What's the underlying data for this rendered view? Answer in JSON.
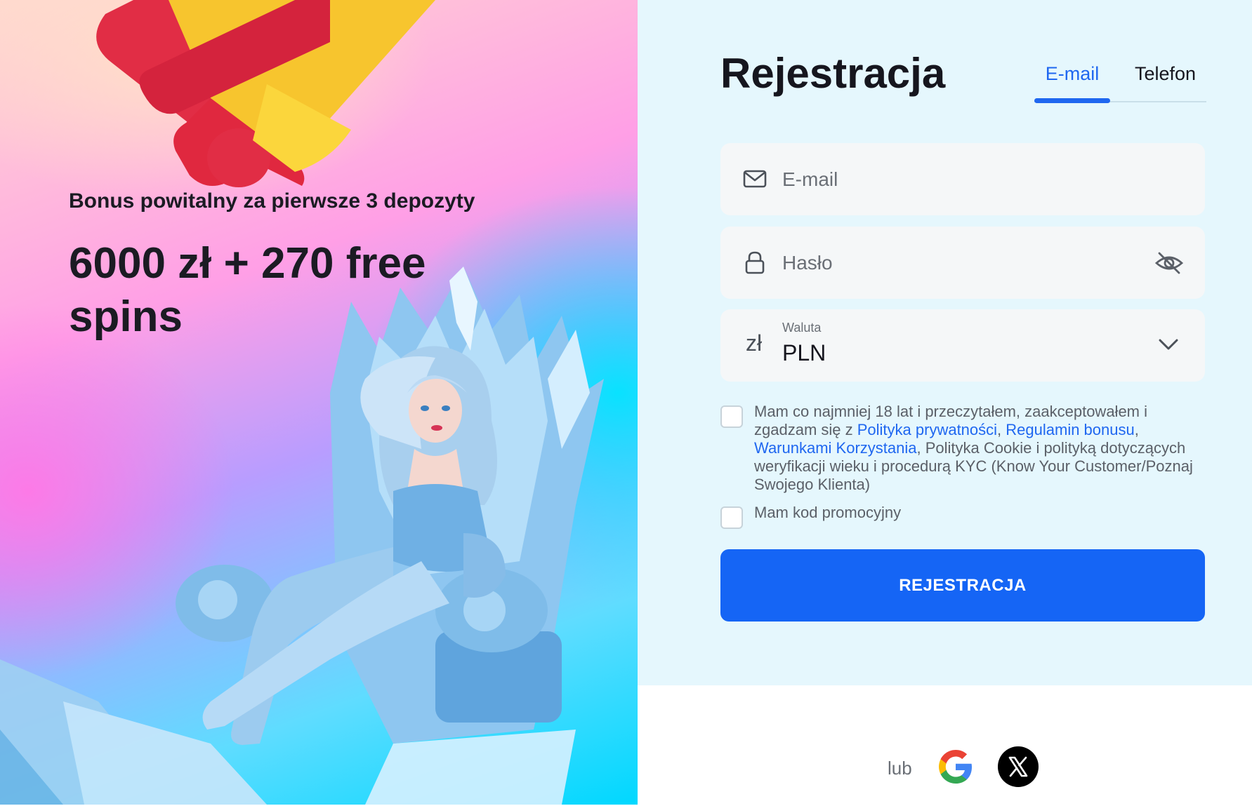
{
  "promo": {
    "subtitle": "Bonus powitalny za pierwsze 3 depozyty",
    "title": "6000 zł + 270 free spins"
  },
  "form": {
    "title": "Rejestracja",
    "tabs": [
      {
        "label": "E-mail",
        "active": true
      },
      {
        "label": "Telefon",
        "active": false
      }
    ],
    "email": {
      "placeholder": "E-mail",
      "value": ""
    },
    "password": {
      "placeholder": "Hasło",
      "value": ""
    },
    "currency": {
      "label": "Waluta",
      "symbol": "zł",
      "value": "PLN"
    },
    "terms": {
      "checked": false,
      "text_before": "Mam co najmniej 18 lat i przeczytałem, zaakceptowałem i zgadzam się z ",
      "link_privacy": "Polityka prywatności",
      "sep1": ", ",
      "link_bonus": "Regulamin bonusu",
      "sep2": ", ",
      "link_terms": "Warunkami Korzystania",
      "text_after": ", Polityka Cookie i polityką dotyczących weryfikacji wieku i procedurą KYC (Know Your Customer/Poznaj Swojego Klienta)"
    },
    "promo_code": {
      "checked": false,
      "label": "Mam kod promocyjny"
    },
    "submit_label": "REJESTRACJA"
  },
  "social": {
    "or_label": "lub",
    "providers": [
      "google-icon",
      "x-icon"
    ]
  },
  "colors": {
    "accent": "#1565f5",
    "link": "#1f67f0",
    "panel_bg": "#e5f7fd",
    "field_bg": "#f5f7f8"
  }
}
